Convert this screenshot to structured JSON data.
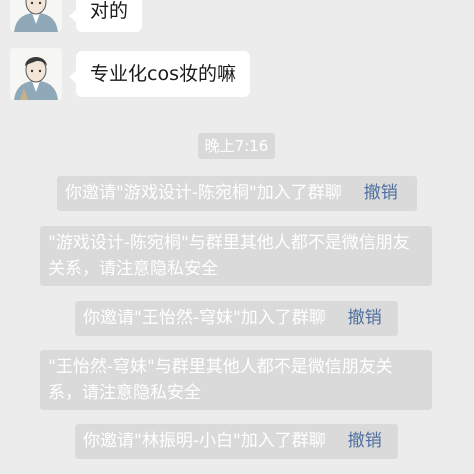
{
  "messages": [
    {
      "sender_avatar": "avatar-boy",
      "text": "对的"
    },
    {
      "sender_avatar": "avatar-boy",
      "text": "专业化cos妆的嘛"
    }
  ],
  "timestamp": "晚上7:16",
  "system_messages": [
    {
      "text": "你邀请\"游戏设计-陈宛桐\"加入了群聊",
      "action": "撤销"
    },
    {
      "text": "\"游戏设计-陈宛桐\"与群里其他人都不是微信朋友关系，请注意隐私安全"
    },
    {
      "text": "你邀请\"王怡然-穹妹\"加入了群聊",
      "action": "撤销"
    },
    {
      "text": "\"王怡然-穹妹\"与群里其他人都不是微信朋友关系，请注意隐私安全"
    },
    {
      "text": "你邀请\"林振明-小白\"加入了群聊",
      "action": "撤销"
    }
  ],
  "colors": {
    "background": "#ececec",
    "bubble": "#ffffff",
    "system_bg": "#dadada",
    "system_text": "#ffffff",
    "link": "#4f6f9f"
  }
}
